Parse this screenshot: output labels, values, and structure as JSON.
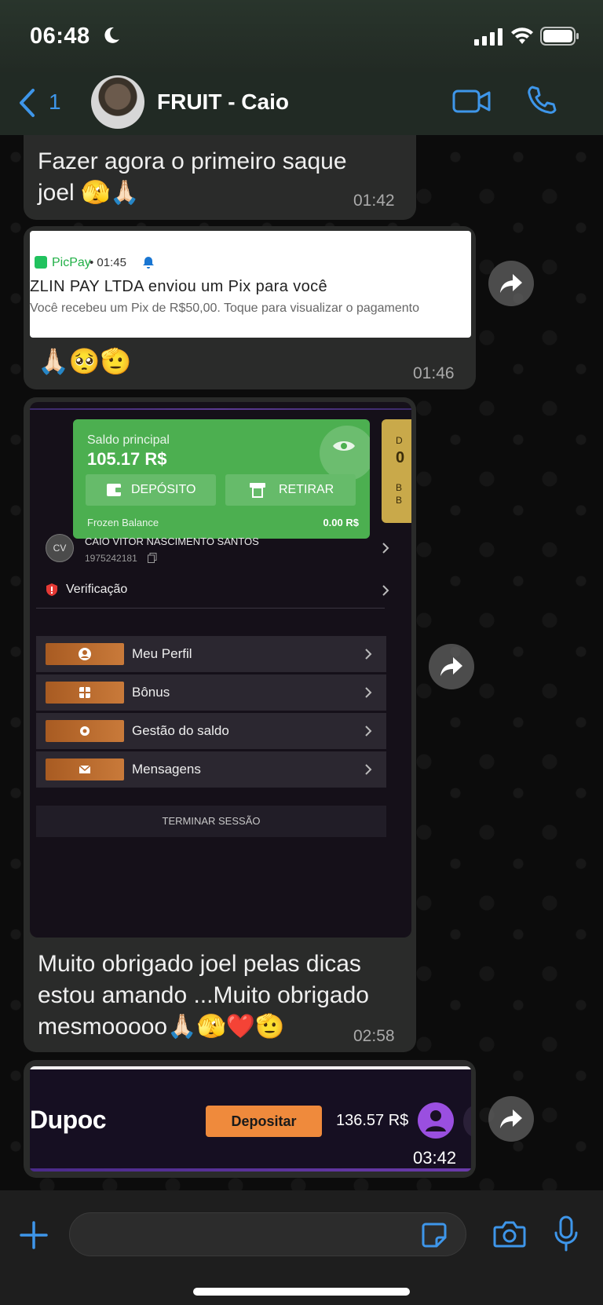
{
  "status_bar": {
    "time": "06:48"
  },
  "header": {
    "back_count": "1",
    "contact_name": "FRUIT - Caio"
  },
  "messages": [
    {
      "text": "Fazer agora o primeiro saque joel 🫣🙏🏻",
      "time": "01:42"
    },
    {
      "emoji": "🙏🏻🥺🫡",
      "time": "01:46",
      "notification": {
        "app": "PicPay",
        "time": "• 01:45",
        "title": "ZLIN PAY LTDA enviou um Pix para você",
        "body": "Você recebeu um Pix de R$50,00. Toque para visualizar o pagamento"
      }
    },
    {
      "text": "Muito obrigado joel pelas dicas estou amando ...Muito obrigado mesmooooo🙏🏻🫣❤️🫡",
      "time": "02:58",
      "screenshot": {
        "balance_label": "Saldo principal",
        "balance_value": "105.17 R$",
        "deposit_label": "DEPÓSITO",
        "withdraw_label": "RETIRAR",
        "frozen_label": "Frozen Balance",
        "frozen_value": "0.00 R$",
        "side_card_top": "D",
        "side_card_value": "0",
        "side_card_b1": "B",
        "side_card_b2": "B",
        "user_initials": "CV",
        "user_name": "CAIO VITOR NASCIMENTO SANTOS",
        "user_id": "1975242181",
        "verification_label": "Verificação",
        "menu": [
          "Meu Perfil",
          "Bônus",
          "Gestão do saldo",
          "Mensagens"
        ],
        "logout_label": "TERMINAR SESSÃO"
      }
    },
    {
      "time": "03:42",
      "dupoc": {
        "logo": "Dupoc",
        "deposit_label": "Depositar",
        "balance": "136.57 R$"
      }
    }
  ],
  "colors": {
    "accent": "#3e96ea",
    "bubble": "#2a2b2a",
    "balance_green": "#4caf50",
    "deposit_orange": "#ef8a3c"
  }
}
